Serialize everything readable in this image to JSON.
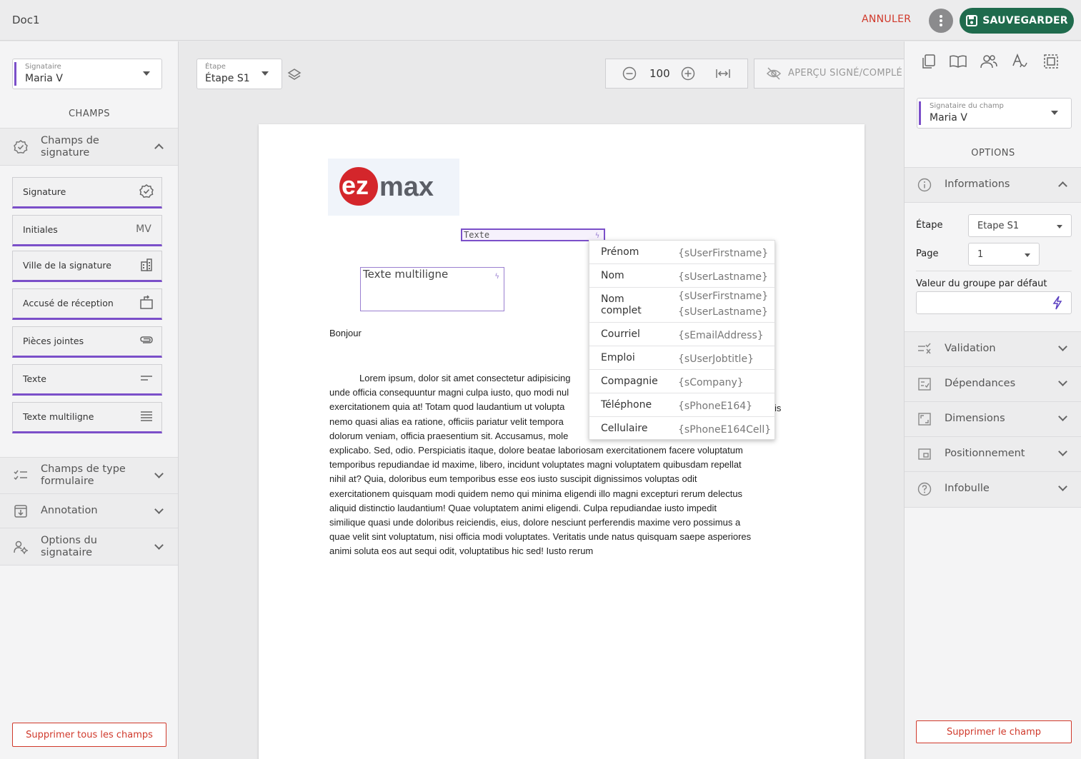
{
  "topbar": {
    "title": "Doc1",
    "cancel_label": "ANNULER",
    "more_icon": "more-vertical-icon",
    "save_label": "SAUVEGARDER",
    "save_icon": "floppy-disk-icon",
    "save_color": "#1f6b4d",
    "cancel_color": "#d0392b"
  },
  "left": {
    "signer_select": {
      "label": "Signataire",
      "value": "Maria V"
    },
    "section_title": "CHAMPS",
    "signature_group": {
      "label_line1": "Champs de",
      "label_line2": "signature"
    },
    "fields": [
      {
        "label": "Signature",
        "icon": "verified-badge-icon"
      },
      {
        "label": "Initiales",
        "icon_text": "MV"
      },
      {
        "label": "Ville de la signature",
        "icon": "city-buildings-icon"
      },
      {
        "label": "Accusé de réception",
        "icon": "receipt-ack-icon"
      },
      {
        "label": "Pièces jointes",
        "icon": "paperclip-icon"
      },
      {
        "label": "Texte",
        "icon": "short-text-icon"
      },
      {
        "label": "Texte multiligne",
        "icon": "multiline-text-icon"
      }
    ],
    "form_group": {
      "label_line1": "Champs de type",
      "label_line2": "formulaire"
    },
    "annotation_group": {
      "label": "Annotation"
    },
    "signer_options_group": {
      "label_line1": "Options du",
      "label_line2": "signataire"
    },
    "delete_all_label": "Supprimer tous les champs",
    "accent_color": "#7b4fc9"
  },
  "center": {
    "step_select": {
      "label": "Étape",
      "value": "Étape S1"
    },
    "zoom_value": "100",
    "apercu_label": "APERÇU SIGNÉ/COMPLÉ",
    "document": {
      "logo_text_ez": "ez",
      "logo_text_max": "max",
      "texte_field_label": "Texte",
      "multiline_field_label": "Texte multiligne",
      "greeting": "Bonjour",
      "lorem_lines": [
        "Lorem ipsum, dolor sit amet consectetur adipisicing",
        "unde officia consequuntur magni culpa iusto, quo modi nul",
        "exercitationem quia at! Totam quod laudantium ut volupta",
        "nemo quasi alias ea ratione, officiis pariatur velit tempora",
        "dolorum veniam, officia praesentium sit. Accusamus, mole",
        "explicabo. Sed, odio. Perspiciatis itaque, dolore beatae laboriosam exercitationem facere voluptatum",
        "temporibus repudiandae id maxime, libero, incidunt voluptates magni voluptatem quibusdam repellat",
        "nihil at? Quia, doloribus eum temporibus esse eos iusto suscipit dignissimos voluptas odit",
        "exercitationem quisquam modi quidem nemo qui minima eligendi illo magni excepturi rerum delectus",
        "aliquid distinctio laudantium! Quae voluptatem animi eligendi. Culpa repudiandae iusto impedit",
        "similique quasi unde doloribus reiciendis, eius, dolore nesciunt perferendis maxime vero possimus a",
        "quae velit sint voluptatum, nisi officia modi voluptates. Veritatis unde natus quisquam saepe asperiores",
        "animi soluta eos aut sequi odit, voluptatibus hic sed! Iusto rerum"
      ],
      "lorem_trailing": "is"
    },
    "variable_dropdown": [
      {
        "label": "Prénom",
        "value": "{sUserFirstname}"
      },
      {
        "label": "Nom",
        "value": "{sUserLastname}"
      },
      {
        "label": "Nom complet",
        "value": "{sUserFirstname} {sUserLastname}"
      },
      {
        "label": "Courriel",
        "value": "{sEmailAddress}"
      },
      {
        "label": "Emploi",
        "value": "{sUserJobtitle}"
      },
      {
        "label": "Compagnie",
        "value": "{sCompany}"
      },
      {
        "label": "Téléphone",
        "value": "{sPhoneE164}"
      },
      {
        "label": "Cellulaire",
        "value": "{sPhoneE164Cell}"
      }
    ]
  },
  "right": {
    "tool_icons": [
      "copy-icon",
      "book-open-icon",
      "users-icon",
      "text-style-icon",
      "select-all-icon"
    ],
    "field_signer_select": {
      "label": "Signataire du champ",
      "value": "Maria V"
    },
    "section_title": "OPTIONS",
    "informations": {
      "label": "Informations",
      "step_label": "Étape",
      "step_value": "Etape S1",
      "page_label": "Page",
      "page_value": "1",
      "default_group_label": "Valeur du groupe par défaut"
    },
    "groups": [
      {
        "label": "Validation",
        "icon": "validation-icon"
      },
      {
        "label": "Dépendances",
        "icon": "dependencies-icon"
      },
      {
        "label": "Dimensions",
        "icon": "dimensions-icon"
      },
      {
        "label": "Positionnement",
        "icon": "positioning-icon"
      },
      {
        "label": "Infobulle",
        "icon": "help-circle-icon"
      }
    ],
    "delete_field_label": "Supprimer le champ"
  }
}
